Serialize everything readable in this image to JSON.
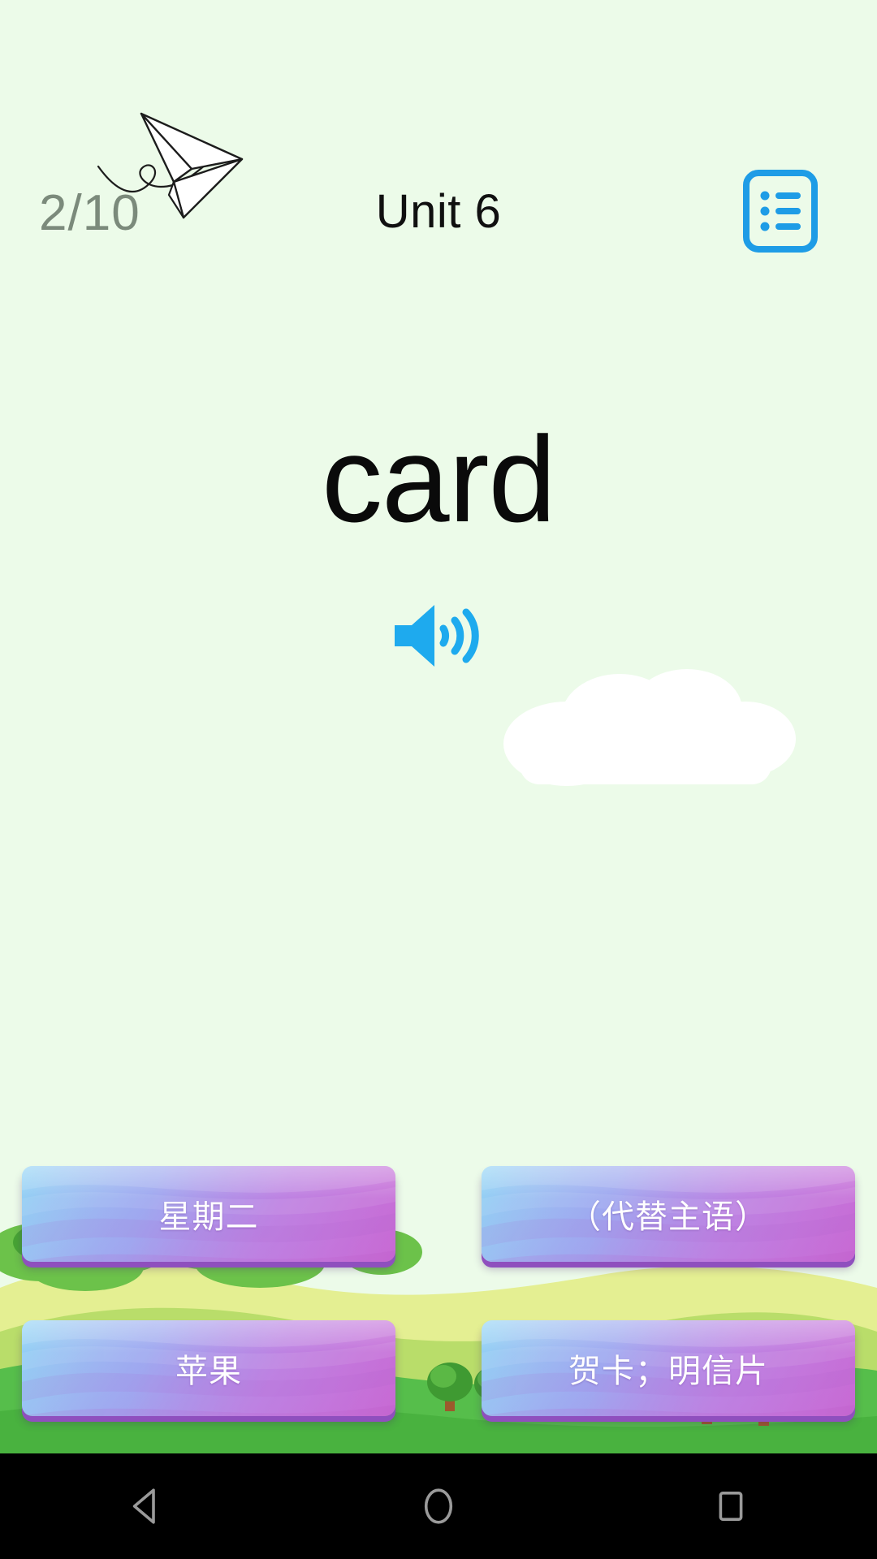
{
  "app": {
    "background_color": "#ecfbe9",
    "accent_blue": "#1e9ce6",
    "counter_color": "#7b8a7b"
  },
  "header": {
    "progress": "2/10",
    "title": "Unit 6",
    "plane_icon": "paper-plane-doodle-icon",
    "list_icon": "list-document-icon"
  },
  "main": {
    "word": "card",
    "speaker_icon": "speaker-volume-icon",
    "cloud_icon": "cloud-decoration"
  },
  "answers": {
    "options": [
      {
        "label": "星期二"
      },
      {
        "label": "（代替主语）"
      },
      {
        "label": "苹果"
      },
      {
        "label": "贺卡；明信片"
      }
    ],
    "gradient_start": "#8fd4f5",
    "gradient_end": "#c46fd4",
    "shadow_color": "#8f4fbe",
    "text_color": "#ffffff"
  },
  "landscape": {
    "sky_color": "#ecfbe9",
    "hill_light": "#e2ee8f",
    "hill_mid": "#a8d957",
    "grass_dark": "#4cb749",
    "tree_color": "#4aa83a"
  },
  "nav_bar": {
    "background": "#000000",
    "icon_color": "#9a9a9a",
    "buttons": [
      {
        "name": "back",
        "glyph": "triangle-left"
      },
      {
        "name": "home",
        "glyph": "circle"
      },
      {
        "name": "recents",
        "glyph": "square"
      }
    ]
  }
}
